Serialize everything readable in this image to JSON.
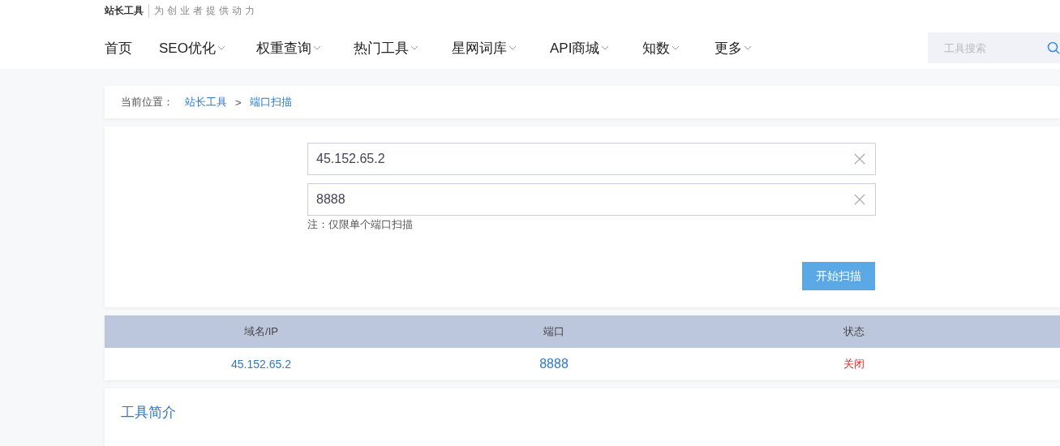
{
  "brand": {
    "name": "站长工具",
    "slogan": "为创业者提供动力"
  },
  "nav": [
    {
      "label": "首页",
      "dropdown": false
    },
    {
      "label": "SEO优化",
      "dropdown": true
    },
    {
      "label": "权重查询",
      "dropdown": true
    },
    {
      "label": "热门工具",
      "dropdown": true
    },
    {
      "label": "星网词库",
      "dropdown": true
    },
    {
      "label": "API商城",
      "dropdown": true
    },
    {
      "label": "知数",
      "dropdown": true
    },
    {
      "label": "更多",
      "dropdown": true
    }
  ],
  "search": {
    "placeholder": "工具搜索"
  },
  "breadcrumb": {
    "label": "当前位置：",
    "items": [
      "站长工具",
      "端口扫描"
    ],
    "separator": ">"
  },
  "form": {
    "fields": [
      {
        "value": "45.152.65.2"
      },
      {
        "value": "8888"
      }
    ],
    "note": "注：仅限单个端口扫描",
    "button": "开始扫描"
  },
  "table": {
    "columns": [
      "域名/IP",
      "端口",
      "状态"
    ],
    "rows": [
      {
        "cells": [
          "45.152.65.2",
          "8888",
          "关闭"
        ],
        "color": "#ee2222"
      }
    ]
  },
  "intro": {
    "title": "工具简介"
  }
}
